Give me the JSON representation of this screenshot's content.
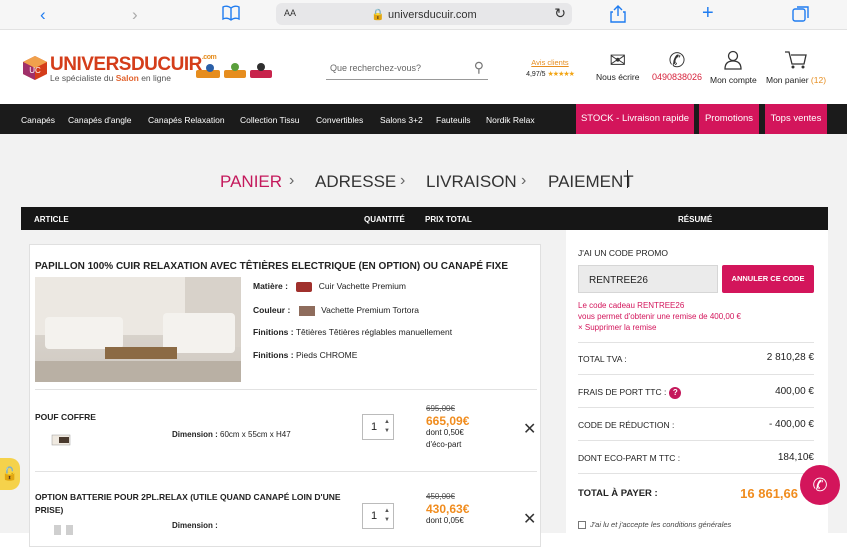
{
  "browser": {
    "aa_label": "AA",
    "url": "universducuir.com",
    "icons": [
      "back-icon",
      "forward-icon",
      "book-icon",
      "lock-icon",
      "reload-icon",
      "share-icon",
      "plus-icon",
      "tabs-icon"
    ]
  },
  "header": {
    "logo_text": "UNIVERSDUCUIR",
    "logo_suffix": ".com",
    "tagline_pre": "Le spécialiste du ",
    "tagline_hl": "Salon",
    "tagline_post": " en ligne",
    "search_placeholder": "Que recherchez-vous?",
    "reviews_title": "Avis clients",
    "reviews_rate": "4,97/5",
    "reviews_stars": "★★★★★",
    "write_label": "Nous écrire",
    "phone_number": "0490838026",
    "account_label": "Mon compte",
    "cart_label": "Mon panier",
    "cart_count": "(12)"
  },
  "nav": {
    "items": [
      "Canapés",
      "Canapés d'angle",
      "Canapés Relaxation",
      "Collection Tissu",
      "Convertibles",
      "Salons 3+2",
      "Fauteuils",
      "Nordik Relax"
    ],
    "buttons": [
      "STOCK - Livraison rapide",
      "Promotions",
      "Tops ventes"
    ]
  },
  "steps": {
    "panier": "PANIER",
    "adresse": "ADRESSE",
    "livraison": "LIVRAISON",
    "paiement": "PAIEMENT",
    "sep": "›"
  },
  "table_head": {
    "article": "ARTICLE",
    "quantite": "QUANTITÉ",
    "prix_total": "PRIX TOTAL",
    "resume": "RÉSUMÉ"
  },
  "product": {
    "title": "PAPILLON 100% CUIR RELAXATION AVEC TÊTIÈRES ELECTRIQUE (EN OPTION) OU CANAPÉ FIXE",
    "matiere_label": "Matière :",
    "matiere_value": "Cuir Vachette Premium",
    "couleur_label": "Couleur :",
    "couleur_value": "Vachette Premium Tortora",
    "couleur_hex": "#8e6c5c",
    "finitions1_label": "Finitions :",
    "finitions1_value": "Têtières Têtières réglables manuellement",
    "finitions2_label": "Finitions :",
    "finitions2_value": "Pieds CHROME"
  },
  "items": [
    {
      "name": "POUF COFFRE",
      "dimension_label": "Dimension :",
      "dimension_value": "60cm x 55cm x H47",
      "qty": "1",
      "old_price": "695,00€",
      "new_price": "665,09€",
      "eco_line1": "dont 0,50€",
      "eco_line2": "d'éco-part"
    },
    {
      "name": "OPTION BATTERIE POUR 2PL.RELAX (UTILE QUAND CANAPÉ LOIN D'UNE PRISE)",
      "dimension_label": "Dimension :",
      "dimension_value": "",
      "qty": "1",
      "old_price": "450,00€",
      "new_price": "430,63€",
      "eco_line1": "dont 0,05€",
      "eco_line2": ""
    }
  ],
  "summary": {
    "promo_title": "J'AI UN CODE PROMO",
    "promo_code": "RENTREE26",
    "promo_button": "ANNULER CE CODE",
    "promo_msg_line1": "Le code cadeau RENTREE26",
    "promo_msg_line2": "vous permet d'obtenir une remise de 400,00 €",
    "promo_remove": "× Supprimer la remise",
    "total_tva_label": "TOTAL TVA :",
    "total_tva_value": "2 810,28 €",
    "frais_label": "FRAIS DE PORT TTC :",
    "frais_value": "400,00 €",
    "reduction_label": "CODE DE RÉDUCTION :",
    "reduction_value": "- 400,00 €",
    "eco_label": "DONT ECO-PART M TTC :",
    "eco_value": "184,10€",
    "total_label": "TOTAL À PAYER :",
    "total_value": "16 861,66",
    "cgv_label": "J'ai lu et j'accepte les conditions générales"
  },
  "colors": {
    "accent": "#d3155b",
    "orange": "#f08c1e",
    "nav_bg": "#1b1b1b"
  }
}
